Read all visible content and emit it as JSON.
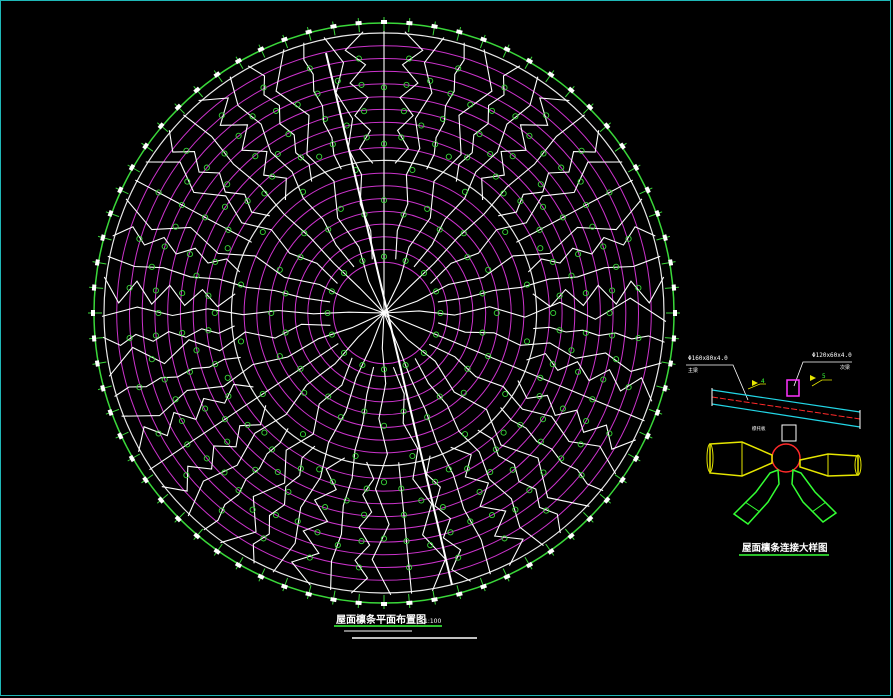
{
  "colors": {
    "background": "#000000",
    "frame": "#1fb7b7",
    "rings": "#cc33cc",
    "outer_ring": "#3ad83a",
    "ribs": "#ffffff",
    "nodes": "#3ad83a",
    "beam_cyan": "#22d6e6",
    "beam_red": "#ff2a2a",
    "pipe_yellow": "#e6e600",
    "tag_magenta": "#ff33ff"
  },
  "plan": {
    "title": "屋面檩条平面布置图",
    "scale": "1:100",
    "note1": "",
    "note2": ""
  },
  "detail": {
    "title": "屋面檩条连接大样图",
    "left_section": "Φ160x80x4.0",
    "left_note": "主梁",
    "right_section": "Φ120x60x4.0",
    "right_note": "次梁",
    "weld_left": "4",
    "weld_right": "5",
    "center_label": "檩托板"
  }
}
